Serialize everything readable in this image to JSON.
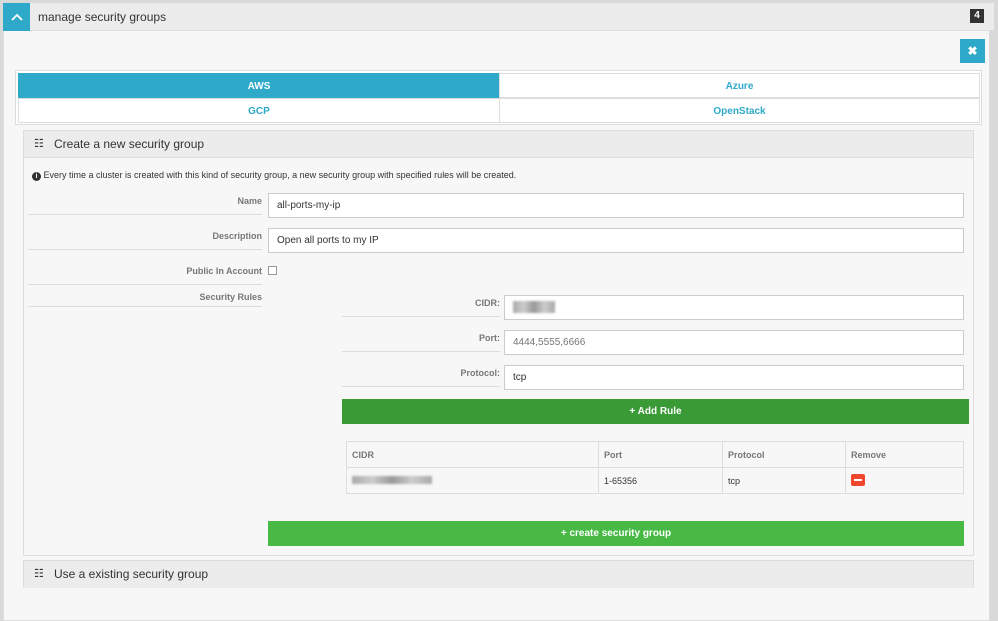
{
  "window": {
    "title": "manage security groups",
    "badge": "4",
    "close": "✖"
  },
  "tabs": [
    {
      "label": "AWS",
      "active": true
    },
    {
      "label": "Azure"
    },
    {
      "label": "GCP"
    },
    {
      "label": "OpenStack"
    }
  ],
  "create_panel": {
    "title": "Create a new security group",
    "info": "Every time a cluster is created with this kind of security group, a new security group with specified rules will be created.",
    "name_label": "Name",
    "name_value": "all-ports-my-ip",
    "description_label": "Description",
    "description_value": "Open all ports to my IP",
    "public_label": "Public In Account",
    "public_checked": false,
    "rules_label": "Security Rules",
    "cidr_label": "CIDR:",
    "port_label": "Port:",
    "port_placeholder": "4444,5555,6666",
    "protocol_label": "Protocol:",
    "protocol_value": "tcp",
    "add_rule": "+ Add Rule",
    "table": {
      "headers": [
        "CIDR",
        "Port",
        "Protocol",
        "Remove"
      ],
      "rows": [
        {
          "port": "1-65356",
          "protocol": "tcp"
        }
      ]
    },
    "create_button": "+  create security group"
  },
  "existing_panel": {
    "title": "Use a existing security group"
  }
}
